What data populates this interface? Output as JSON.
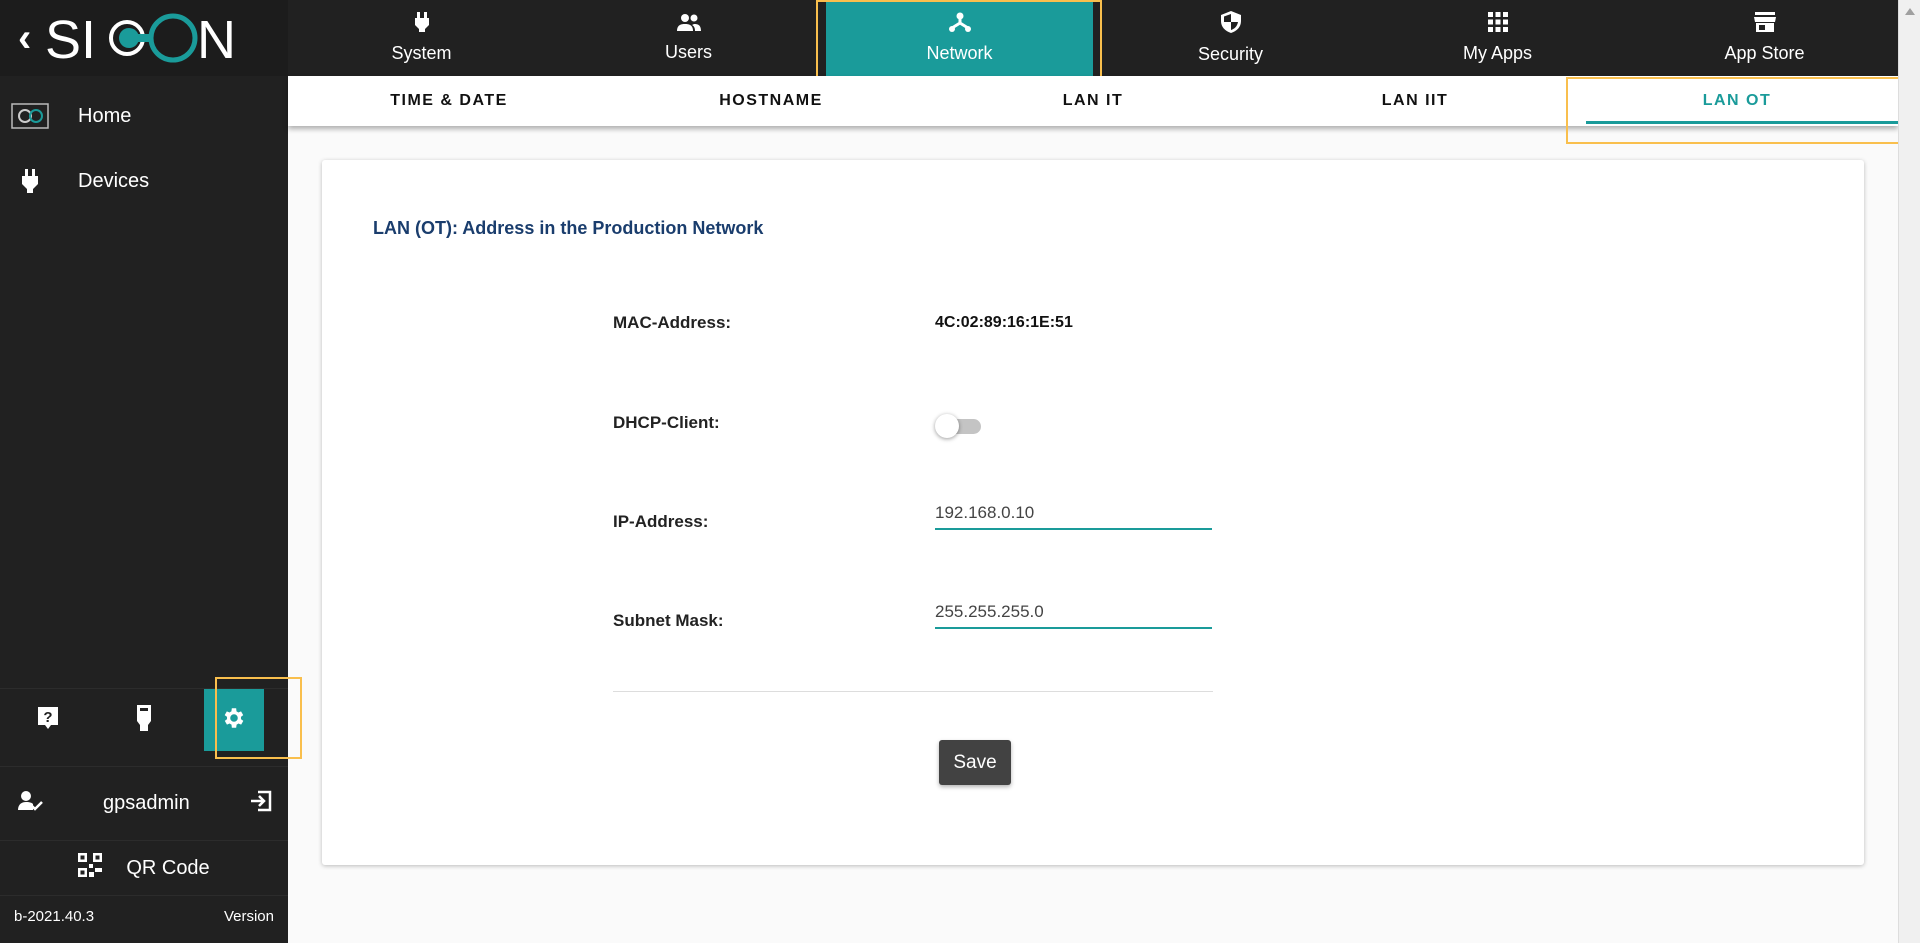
{
  "brand": {
    "logo_text": "SICON",
    "accent": "#1a9b9a",
    "highlight": "#f9bf4d"
  },
  "sidebar": {
    "items": [
      {
        "label": "Home",
        "icon": "sicon-logo-icon"
      },
      {
        "label": "Devices",
        "icon": "plug-icon"
      }
    ],
    "bottom_icons": [
      "help-icon",
      "ethernet-icon",
      "gear-icon"
    ],
    "user": {
      "name": "gpsadmin"
    },
    "qr_label": "QR Code",
    "version_value": "b-2021.40.3",
    "version_label": "Version"
  },
  "topnav": {
    "tabs": [
      {
        "label": "System",
        "icon": "plug-icon"
      },
      {
        "label": "Users",
        "icon": "users-icon"
      },
      {
        "label": "Network",
        "icon": "network-icon",
        "active": true
      },
      {
        "label": "Security",
        "icon": "shield-icon"
      },
      {
        "label": "My Apps",
        "icon": "apps-grid-icon"
      },
      {
        "label": "App Store",
        "icon": "store-icon"
      }
    ]
  },
  "subtabs": [
    {
      "label": "TIME & DATE"
    },
    {
      "label": "HOSTNAME"
    },
    {
      "label": "LAN IT"
    },
    {
      "label": "LAN IIT"
    },
    {
      "label": "LAN OT",
      "active": true
    }
  ],
  "form": {
    "title": "LAN (OT): Address in the Production Network",
    "mac_label": "MAC-Address:",
    "mac_value": "4C:02:89:16:1E:51",
    "dhcp_label": "DHCP-Client:",
    "dhcp_enabled": false,
    "ip_label": "IP-Address:",
    "ip_value": "192.168.0.10",
    "subnet_label": "Subnet Mask:",
    "subnet_value": "255.255.255.0",
    "save_label": "Save"
  }
}
